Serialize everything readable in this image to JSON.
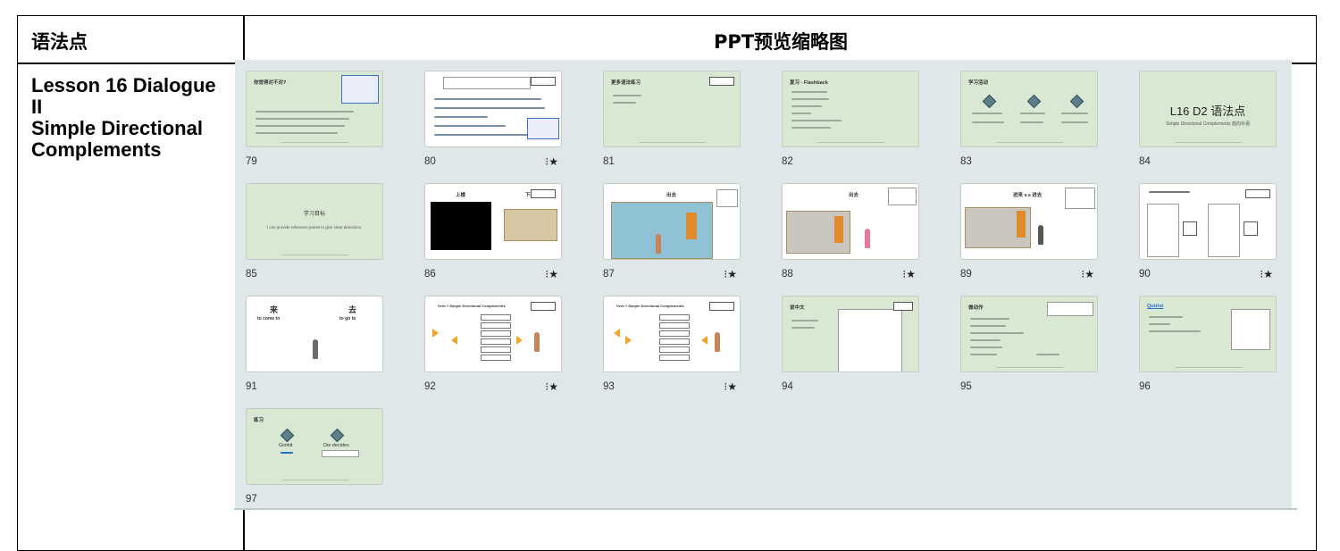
{
  "table": {
    "header_left": "语法点",
    "header_right": "PPT预览缩略图",
    "grammar_lines": [
      "Lesson 16 Dialogue",
      "II",
      "Simple Directional",
      "Complements"
    ]
  },
  "thumbnails": [
    {
      "num": "79",
      "title": "你觉得对不对?",
      "starred": false
    },
    {
      "num": "80",
      "title": "",
      "starred": true
    },
    {
      "num": "81",
      "title": "更多语法练习",
      "starred": false
    },
    {
      "num": "82",
      "title": "复习 - Flashback",
      "starred": false
    },
    {
      "num": "83",
      "title": "学习活动",
      "starred": false
    },
    {
      "num": "84",
      "title": "L16 D2 语法点",
      "subtitle": "Simple Directional Complements 趋向补语",
      "starred": false
    },
    {
      "num": "85",
      "title": "学习目标",
      "subtitle": "I can provide reference points to give clear directions.",
      "starred": false
    },
    {
      "num": "86",
      "title": "上楼",
      "title2": "下楼",
      "starred": true
    },
    {
      "num": "87",
      "title": "出去",
      "starred": true
    },
    {
      "num": "88",
      "title": "出去",
      "starred": true
    },
    {
      "num": "89",
      "title": "进来 v.s 进去",
      "starred": true
    },
    {
      "num": "90",
      "title": "",
      "starred": true
    },
    {
      "num": "91",
      "title": "来",
      "title2": "去",
      "sub1": "to come to",
      "sub2": "to go to",
      "starred": false
    },
    {
      "num": "92",
      "title": "Verb + Simple Directional Complements",
      "starred": true
    },
    {
      "num": "93",
      "title": "Verb + Simple Directional Complements",
      "starred": true
    },
    {
      "num": "94",
      "title": "说中文",
      "starred": false
    },
    {
      "num": "95",
      "title": "做动作",
      "starred": false
    },
    {
      "num": "96",
      "title": "Quizlet",
      "starred": false
    },
    {
      "num": "97",
      "title": "练习",
      "labels": [
        "Gimkit",
        "Die decides"
      ],
      "starred": false
    }
  ],
  "star_glyph": "⁝★",
  "colors": {
    "slide_bg": "#d9e8d3",
    "panel_bg": "#dfe7e8",
    "accent_orange": "#f0a62c"
  }
}
